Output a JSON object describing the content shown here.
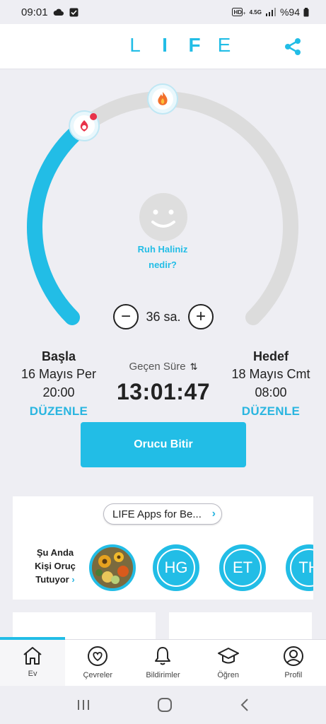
{
  "status_bar": {
    "time": "09:01",
    "network": "4.5G",
    "battery": "%94"
  },
  "header": {
    "logo_letters": [
      "L",
      "I",
      "F",
      "E"
    ]
  },
  "ring": {
    "progress_fraction": 0.36,
    "colors": {
      "progress": "#22bde6",
      "track": "#dcdcdc"
    },
    "mood_prompt_line1": "Ruh Haliniz",
    "mood_prompt_line2": "nedir?",
    "duration_label": "36 sa.",
    "minus_label": "−",
    "plus_label": "+"
  },
  "start": {
    "title": "Başla",
    "date": "16 Mayıs Per",
    "time": "20:00",
    "edit_label": "DÜZENLE"
  },
  "elapsed": {
    "label": "Geçen Süre",
    "swap_glyph": "⇅",
    "value": "13:01:47"
  },
  "target": {
    "title": "Hedef",
    "date": "18 Mayıs Cmt",
    "time": "08:00",
    "edit_label": "DÜZENLE"
  },
  "end_fast_button": "Orucu Bitir",
  "community": {
    "promo_label": "LIFE Apps for Be...",
    "promo_chevron": "›",
    "fasting_now_line1": "Şu Anda",
    "fasting_now_line2": "Kişi Oruç",
    "fasting_now_line3": "Tutuyor",
    "fasting_now_chevron": "›",
    "avatars": [
      {
        "initials": "",
        "kind": "photo"
      },
      {
        "initials": "HG",
        "kind": "initials"
      },
      {
        "initials": "ET",
        "kind": "initials"
      },
      {
        "initials": "TH",
        "kind": "initials"
      }
    ]
  },
  "bottom_nav": {
    "items": [
      {
        "label": "Ev",
        "icon": "home-icon",
        "active": true
      },
      {
        "label": "Çevreler",
        "icon": "heart-circle-icon",
        "active": false
      },
      {
        "label": "Bildirimler",
        "icon": "bell-icon",
        "active": false
      },
      {
        "label": "Öğren",
        "icon": "graduation-cap-icon",
        "active": false
      },
      {
        "label": "Profil",
        "icon": "profile-icon",
        "active": false
      }
    ]
  },
  "accent_color": "#22bde6"
}
